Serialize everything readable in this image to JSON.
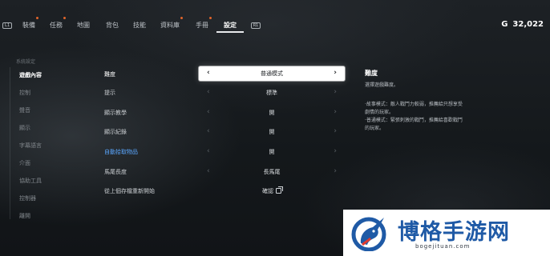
{
  "nav": {
    "left_key": "L1",
    "right_key": "R1",
    "tabs": [
      {
        "label": "裝備",
        "dot": true
      },
      {
        "label": "任務",
        "dot": true
      },
      {
        "label": "地圖",
        "dot": false
      },
      {
        "label": "背包",
        "dot": false
      },
      {
        "label": "技能",
        "dot": false
      },
      {
        "label": "資料庫",
        "dot": true
      },
      {
        "label": "手冊",
        "dot": true
      },
      {
        "label": "設定",
        "dot": false,
        "active": true
      }
    ],
    "currency_icon": "G",
    "currency_value": "32,022"
  },
  "sidebar": {
    "caption": "系統設定",
    "items": [
      {
        "label": "遊戲內容",
        "active": true
      },
      {
        "label": "控制"
      },
      {
        "label": "聲音"
      },
      {
        "label": "顯示"
      },
      {
        "label": "字幕語言"
      },
      {
        "label": "介面"
      },
      {
        "label": "協助工具"
      },
      {
        "label": "控制器"
      },
      {
        "label": "離開"
      }
    ]
  },
  "settings": [
    {
      "label": "難度",
      "value": "普通模式",
      "selected": true
    },
    {
      "label": "提示",
      "value": "標準"
    },
    {
      "label": "顯示教學",
      "value": "開"
    },
    {
      "label": "顯示紀錄",
      "value": "開"
    },
    {
      "label": "自動拾取物品",
      "value": "開",
      "highlight": true
    },
    {
      "label": "馬尾長度",
      "value": "長馬尾"
    },
    {
      "label": "從上個存檔重新開始",
      "value": "確認",
      "external": true
    }
  ],
  "description": {
    "title": "難度",
    "lines": [
      "選擇遊戲難度。",
      "",
      "·故事模式：敵人戰鬥力較弱，推薦給只想享受",
      "劇情的玩家。",
      "·普通模式：緊張刺激的戰鬥，推薦給喜歡戰鬥",
      "的玩家。"
    ]
  },
  "watermark": {
    "title": "博格手游网",
    "url": "bogejituan.com",
    "logo_icon": "unicorn-logo-icon",
    "brand_color": "#1f5aa6"
  }
}
